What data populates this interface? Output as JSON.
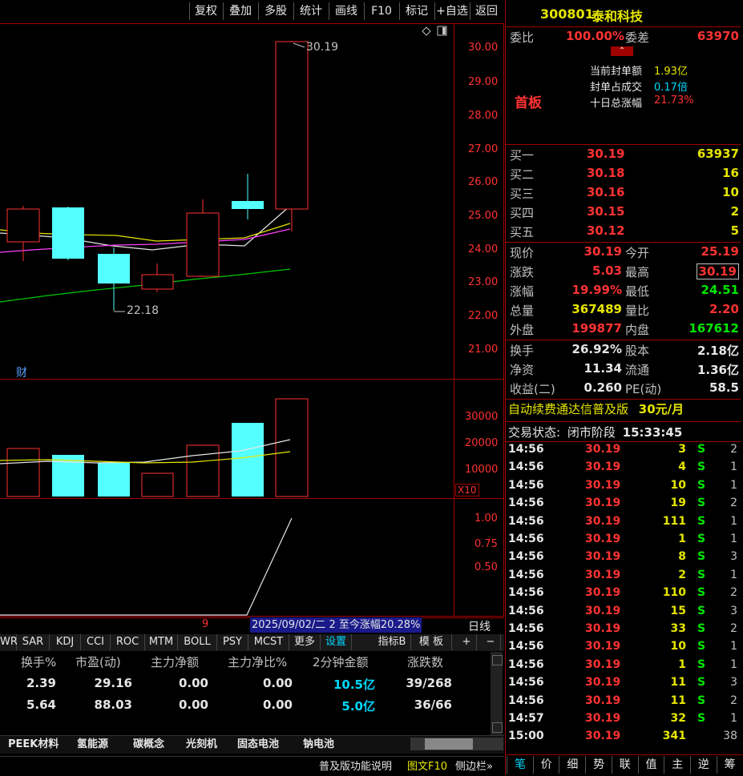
{
  "toolbar": [
    "复权",
    "叠加",
    "多股",
    "统计",
    "画线",
    "F10",
    "标记",
    "+自选",
    "返回"
  ],
  "stock": {
    "code": "300801",
    "name": "泰和科技"
  },
  "weibi": {
    "label": "委比",
    "value": "100.00%",
    "diff_label": "委差",
    "diff_value": "63970"
  },
  "limit": {
    "tag": "首板",
    "rows": [
      {
        "label": "当前封单额",
        "value": "1.93亿"
      },
      {
        "label": "封单占成交",
        "value": "0.17倍"
      },
      {
        "label": "十日总涨幅",
        "value": "21.73%"
      }
    ]
  },
  "bids": [
    {
      "label": "买一",
      "price": "30.19",
      "vol": "63937"
    },
    {
      "label": "买二",
      "price": "30.18",
      "vol": "16"
    },
    {
      "label": "买三",
      "price": "30.16",
      "vol": "10"
    },
    {
      "label": "买四",
      "price": "30.15",
      "vol": "2"
    },
    {
      "label": "买五",
      "price": "30.12",
      "vol": "5"
    }
  ],
  "quote": [
    {
      "l1": "现价",
      "v1": "30.19",
      "l2": "今开",
      "v2": "25.19"
    },
    {
      "l1": "涨跌",
      "v1": "5.03",
      "l2": "最高",
      "v2": "30.19"
    },
    {
      "l1": "涨幅",
      "v1": "19.99%",
      "l2": "最低",
      "v2": "24.51"
    },
    {
      "l1": "总量",
      "v1": "367489",
      "l2": "量比",
      "v2": "2.20"
    },
    {
      "l1": "外盘",
      "v1": "199877",
      "l2": "内盘",
      "v2": "167612"
    }
  ],
  "stats": [
    {
      "l1": "换手",
      "v1": "26.92%",
      "l2": "股本",
      "v2": "2.18亿"
    },
    {
      "l1": "净资",
      "v1": "11.34",
      "l2": "流通",
      "v2": "1.36亿"
    },
    {
      "l1": "收益(二)",
      "v1": "0.260",
      "l2": "PE(动)",
      "v2": "58.5"
    }
  ],
  "ad": {
    "text": "自动续费通达信普及版",
    "price": "30元/月"
  },
  "status": {
    "label": "交易状态:",
    "value": "闭市阶段",
    "time": "15:33:45"
  },
  "ticks": [
    {
      "t": "14:56",
      "p": "30.19",
      "v": "3",
      "s": "S",
      "n": "2"
    },
    {
      "t": "14:56",
      "p": "30.19",
      "v": "4",
      "s": "S",
      "n": "1"
    },
    {
      "t": "14:56",
      "p": "30.19",
      "v": "10",
      "s": "S",
      "n": "1"
    },
    {
      "t": "14:56",
      "p": "30.19",
      "v": "19",
      "s": "S",
      "n": "2"
    },
    {
      "t": "14:56",
      "p": "30.19",
      "v": "111",
      "s": "S",
      "n": "1"
    },
    {
      "t": "14:56",
      "p": "30.19",
      "v": "1",
      "s": "S",
      "n": "1"
    },
    {
      "t": "14:56",
      "p": "30.19",
      "v": "8",
      "s": "S",
      "n": "3"
    },
    {
      "t": "14:56",
      "p": "30.19",
      "v": "2",
      "s": "S",
      "n": "1"
    },
    {
      "t": "14:56",
      "p": "30.19",
      "v": "110",
      "s": "S",
      "n": "2"
    },
    {
      "t": "14:56",
      "p": "30.19",
      "v": "15",
      "s": "S",
      "n": "3"
    },
    {
      "t": "14:56",
      "p": "30.19",
      "v": "33",
      "s": "S",
      "n": "2"
    },
    {
      "t": "14:56",
      "p": "30.19",
      "v": "10",
      "s": "S",
      "n": "1"
    },
    {
      "t": "14:56",
      "p": "30.19",
      "v": "1",
      "s": "S",
      "n": "1"
    },
    {
      "t": "14:56",
      "p": "30.19",
      "v": "11",
      "s": "S",
      "n": "3"
    },
    {
      "t": "14:56",
      "p": "30.19",
      "v": "11",
      "s": "S",
      "n": "2"
    },
    {
      "t": "14:57",
      "p": "30.19",
      "v": "32",
      "s": "S",
      "n": "1"
    },
    {
      "t": "15:00",
      "p": "30.19",
      "v": "341",
      "s": "",
      "n": "38"
    }
  ],
  "bottom_tabs": [
    "笔",
    "价",
    "细",
    "势",
    "联",
    "值",
    "主",
    "逆",
    "筹"
  ],
  "chart": {
    "price_axis": [
      "30.00",
      "29.00",
      "28.00",
      "27.00",
      "26.00",
      "25.00",
      "24.00",
      "23.00",
      "22.00",
      "21.00"
    ],
    "vol_axis": [
      "30000",
      "20000",
      "10000"
    ],
    "vol_unit": "X10",
    "ind_axis": [
      "1.00",
      "0.75",
      "0.50"
    ],
    "high_label": "30.19",
    "low_label": "22.18",
    "cai": "财",
    "nine": "9",
    "range_info": "2025/09/02/二 2 至今涨幅20.28%",
    "period": "日线"
  },
  "indicators": [
    "WR",
    "SAR",
    "KDJ",
    "CCI",
    "ROC",
    "MTM",
    "BOLL",
    "PSY",
    "MCST",
    "更多",
    "设置"
  ],
  "ind_right": [
    "指标B",
    "模 板",
    "+",
    "−"
  ],
  "table": {
    "headers": [
      "换手%",
      "市盈(动)",
      "主力净额",
      "主力净比%",
      "2分钟金额",
      "涨跌数"
    ],
    "rows": [
      [
        "2.39",
        "29.16",
        "0.00",
        "0.00",
        "10.5亿",
        "39/268"
      ],
      [
        "5.64",
        "88.03",
        "0.00",
        "0.00",
        "5.0亿",
        "36/66"
      ]
    ]
  },
  "categories": [
    "PEEK材料",
    "氢能源",
    "碳概念",
    "光刻机",
    "固态电池",
    "钠电池"
  ],
  "footer": {
    "help": "普及版功能说明",
    "tuwen": "图文F10",
    "side": "侧边栏»"
  }
}
